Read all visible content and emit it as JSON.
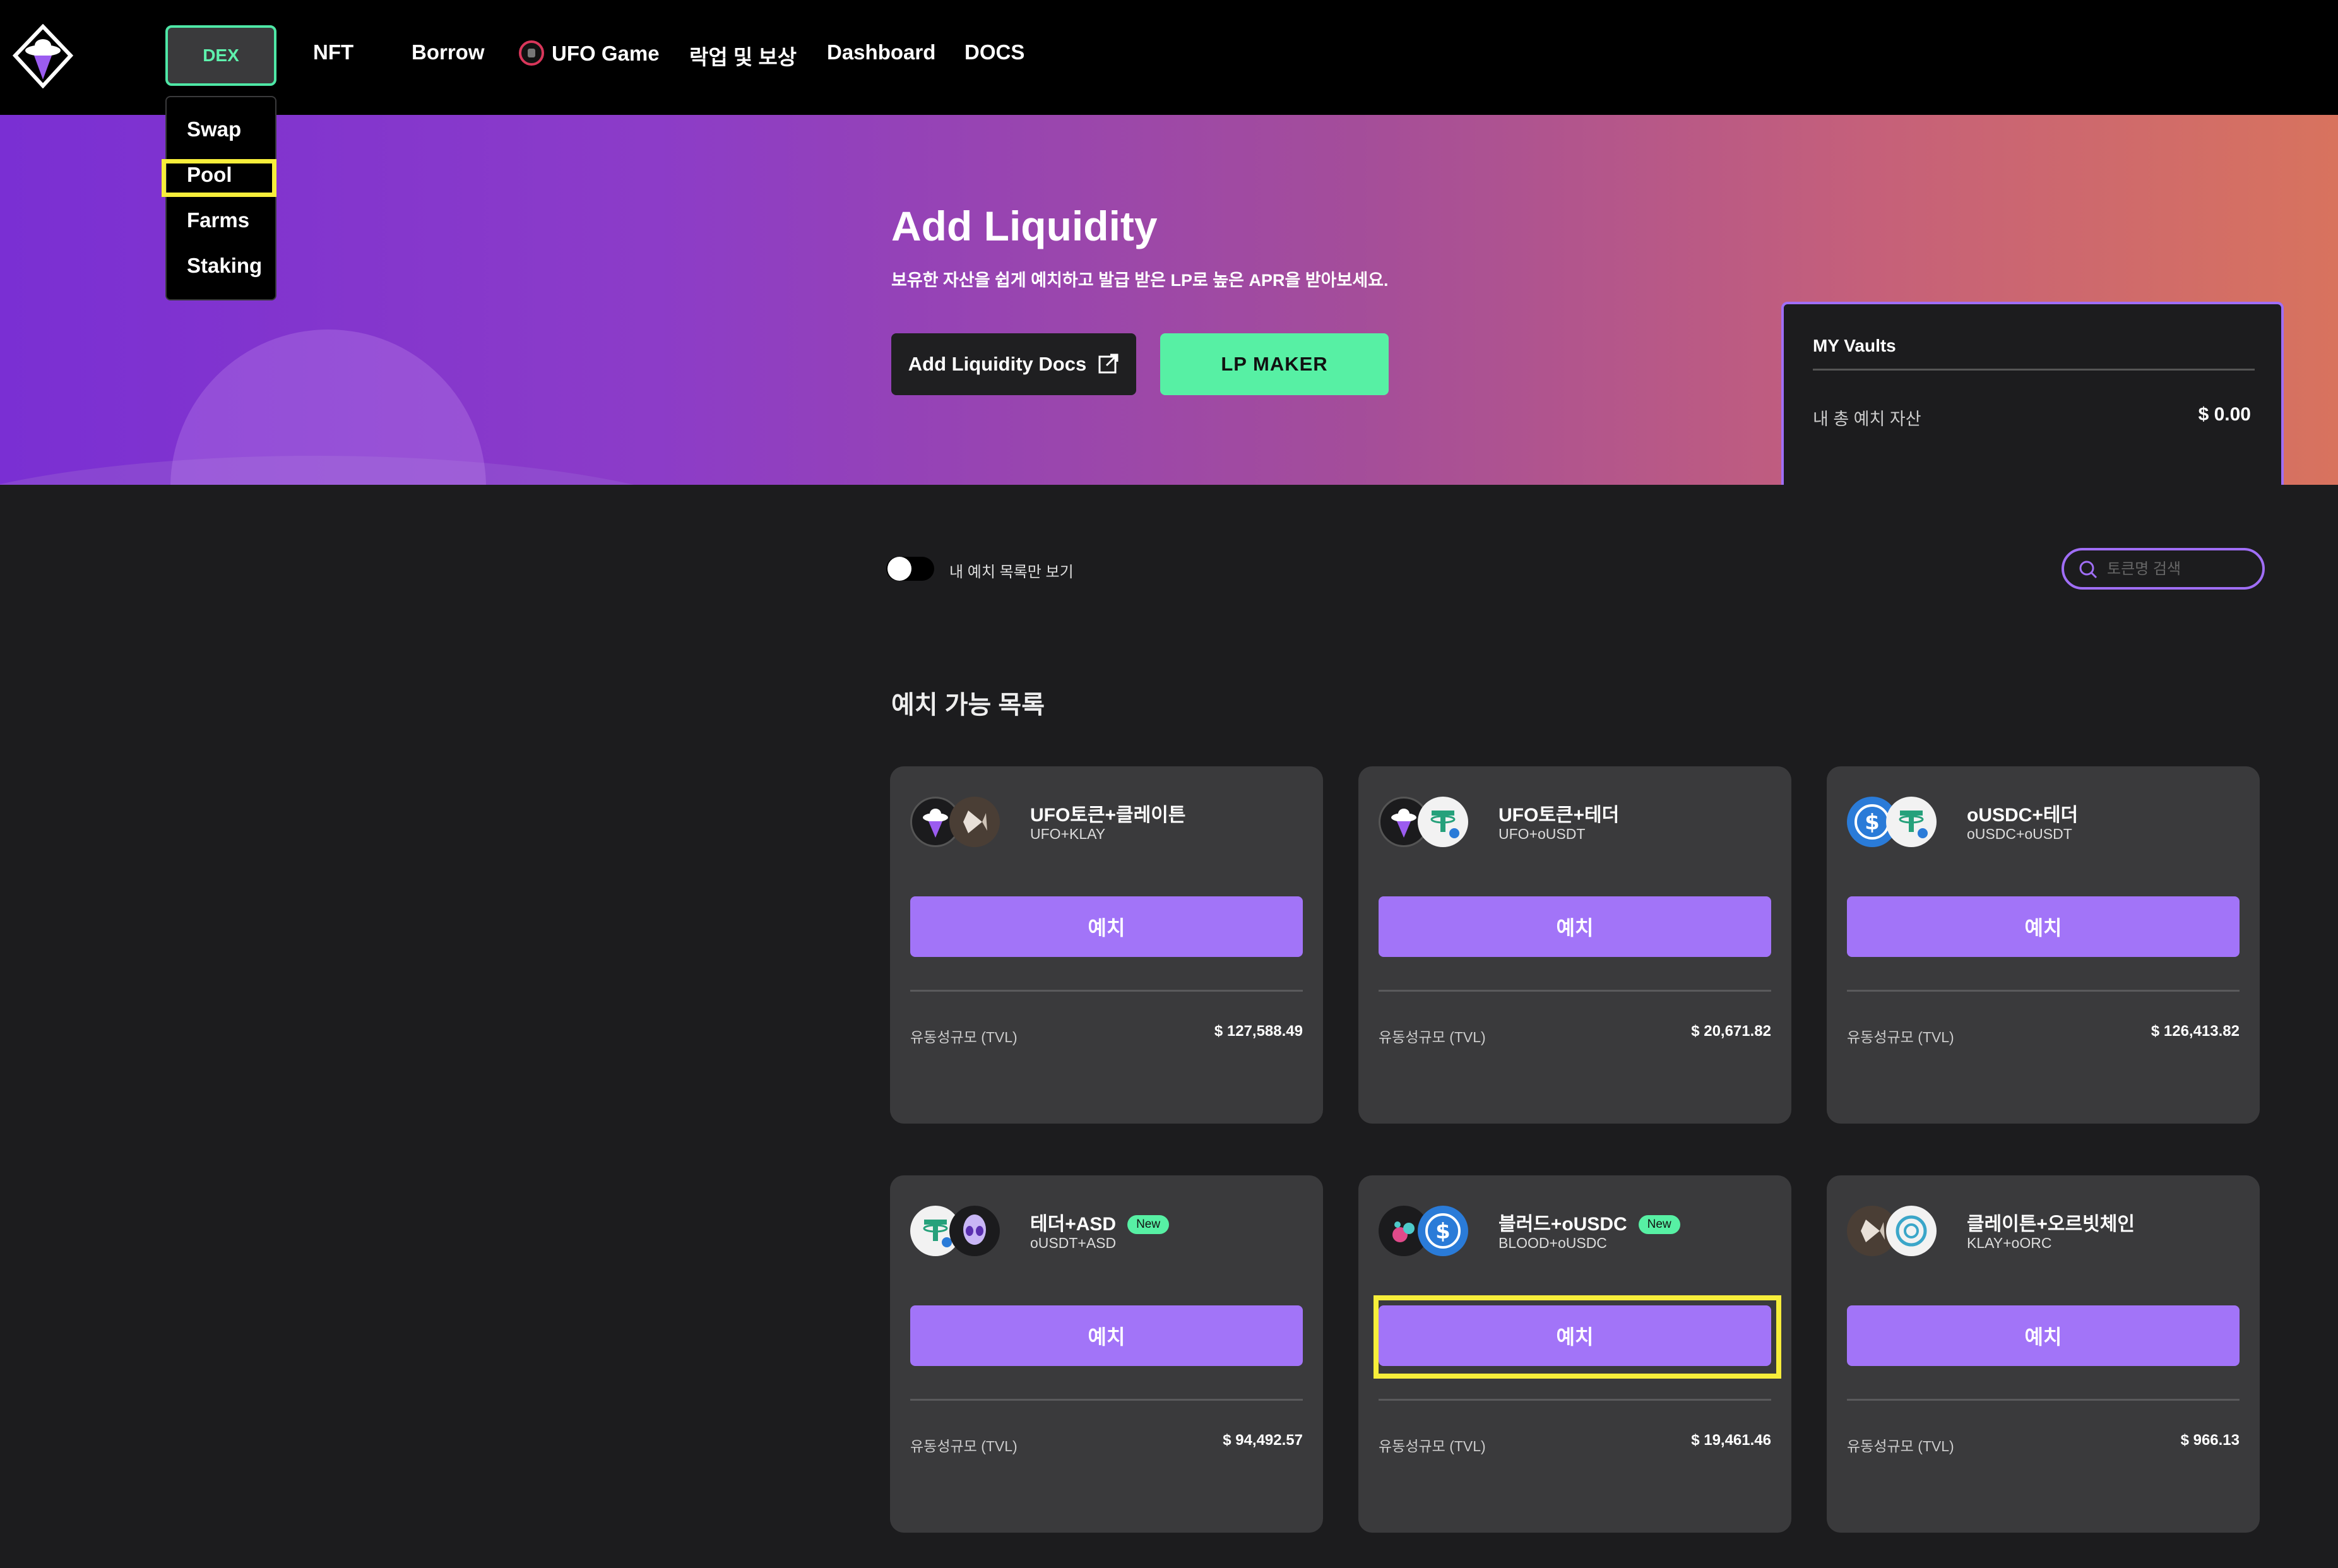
{
  "nav": {
    "items": [
      {
        "label": "DEX"
      },
      {
        "label": "NFT"
      },
      {
        "label": "Borrow"
      },
      {
        "label": "UFO Game"
      },
      {
        "label": "락업 및 보상"
      },
      {
        "label": "Dashboard"
      },
      {
        "label": "DOCS"
      }
    ],
    "dropdown": [
      "Swap",
      "Pool",
      "Farms",
      "Staking"
    ]
  },
  "hero": {
    "title": "Add Liquidity",
    "subtitle": "보유한 자산을 쉽게 예치하고 발급 받은 LP로 높은 APR을 받아보세요.",
    "docs_button": "Add Liquidity Docs",
    "lp_button": "LP MAKER"
  },
  "vaults": {
    "title": "MY Vaults",
    "label": "내 총 예치 자산",
    "value": "$ 0.00"
  },
  "filter": {
    "toggle_label": "내 예치 목록만 보기",
    "search_placeholder": "토큰명 검색"
  },
  "section_title": "예치 가능 목록",
  "pools": [
    {
      "name": "UFO토큰+클레이튼",
      "pair": "UFO+KLAY",
      "is_new": false,
      "button": "예치",
      "tvl_label": "유동성규모 (TVL)",
      "tvl": "$ 127,588.49",
      "icons": [
        "ufo-token-icon",
        "klay-token-icon"
      ]
    },
    {
      "name": "UFO토큰+테더",
      "pair": "UFO+oUSDT",
      "is_new": false,
      "button": "예치",
      "tvl_label": "유동성규모 (TVL)",
      "tvl": "$ 20,671.82",
      "icons": [
        "ufo-token-icon",
        "tether-token-icon"
      ]
    },
    {
      "name": "oUSDC+테더",
      "pair": "oUSDC+oUSDT",
      "is_new": false,
      "button": "예치",
      "tvl_label": "유동성규모 (TVL)",
      "tvl": "$ 126,413.82",
      "icons": [
        "usdc-token-icon",
        "tether-token-icon"
      ]
    },
    {
      "name": "테더+ASD",
      "pair": "oUSDT+ASD",
      "is_new": true,
      "new_label": "New",
      "button": "예치",
      "tvl_label": "유동성규모 (TVL)",
      "tvl": "$ 94,492.57",
      "icons": [
        "tether-token-icon",
        "asd-token-icon"
      ]
    },
    {
      "name": "블러드+oUSDC",
      "pair": "BLOOD+oUSDC",
      "is_new": true,
      "new_label": "New",
      "button": "예치",
      "tvl_label": "유동성규모 (TVL)",
      "tvl": "$ 19,461.46",
      "icons": [
        "blood-token-icon",
        "usdc-token-icon"
      ]
    },
    {
      "name": "클레이튼+오르빗체인",
      "pair": "KLAY+oORC",
      "is_new": false,
      "button": "예치",
      "tvl_label": "유동성규모 (TVL)",
      "tvl": "$ 966.13",
      "icons": [
        "klay-token-icon",
        "orbit-token-icon"
      ]
    }
  ],
  "colors": {
    "accent_green": "#57f0a4",
    "accent_purple": "#a274f8",
    "highlight_yellow": "#f7ee3a",
    "card_bg": "#3a3a3c",
    "page_bg": "#1c1c1e"
  }
}
